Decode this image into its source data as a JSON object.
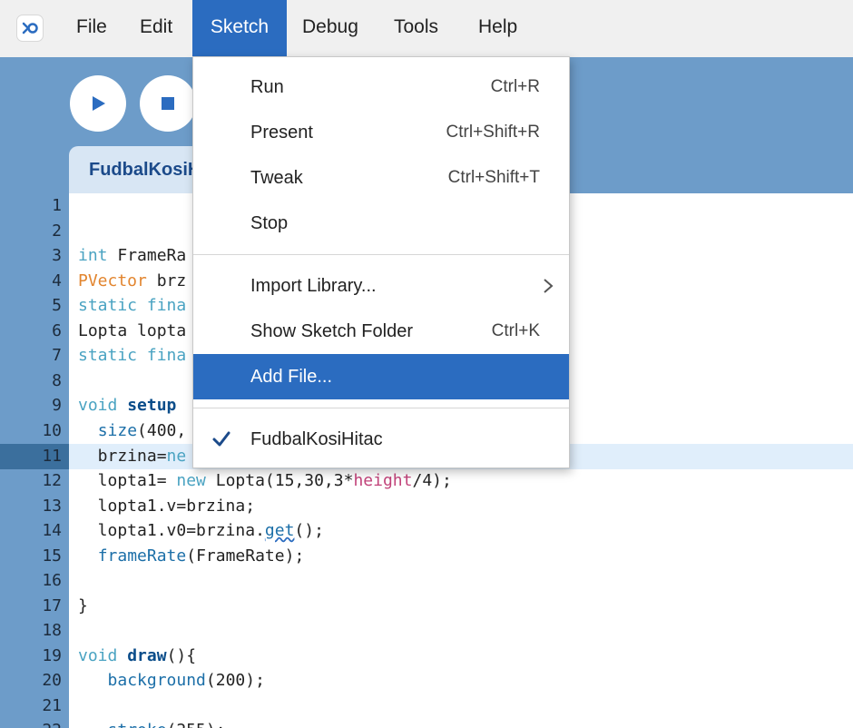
{
  "menubar": {
    "items": [
      {
        "label": "File"
      },
      {
        "label": "Edit"
      },
      {
        "label": "Sketch"
      },
      {
        "label": "Debug"
      },
      {
        "label": "Tools"
      },
      {
        "label": "Help"
      }
    ],
    "active": "Sketch"
  },
  "toolbar": {
    "run_icon": "play-icon",
    "stop_icon": "stop-icon"
  },
  "tab": {
    "label": "FudbalKosiHitac"
  },
  "editor": {
    "current_line": 11,
    "line_numbers": [
      "1",
      "2",
      "3",
      "4",
      "5",
      "6",
      "7",
      "8",
      "9",
      "10",
      "11",
      "12",
      "13",
      "14",
      "15",
      "16",
      "17",
      "18",
      "19",
      "20",
      "21",
      "22"
    ],
    "visible_code": {
      "l3": "int FrameRa",
      "l4": "PVector brz",
      "l5": "static fina",
      "l6": "Lopta lopta",
      "l7": "static fina",
      "l9": "void setup",
      "l10": "  size(400,",
      "l11": "  brzina=ne",
      "l12": "  lopta1= new Lopta(15,30,3*height/4);",
      "l13": "  lopta1.v=brzina;",
      "l14": "  lopta1.v0=brzina.get();",
      "l15": "  frameRate(FrameRate);",
      "l17": "}",
      "l19": "void draw(){",
      "l20": "   background(200);",
      "l22": "   stroke(255);"
    }
  },
  "sketch_menu": {
    "items": [
      {
        "label": "Run",
        "shortcut": "Ctrl+R"
      },
      {
        "label": "Present",
        "shortcut": "Ctrl+Shift+R"
      },
      {
        "label": "Tweak",
        "shortcut": "Ctrl+Shift+T"
      },
      {
        "label": "Stop",
        "shortcut": ""
      },
      {
        "label": "Import Library...",
        "shortcut": ""
      },
      {
        "label": "Show Sketch Folder",
        "shortcut": "Ctrl+K"
      },
      {
        "label": "Add File...",
        "shortcut": ""
      },
      {
        "label": "FudbalKosiHitac",
        "shortcut": ""
      }
    ],
    "selected": "Add File...",
    "checked": "FudbalKosiHitac"
  },
  "colors": {
    "accent": "#2b6cc0",
    "toolbar_bg": "#6d9cc9",
    "menubar_bg": "#f0f0f0",
    "keyword": "#4aa3c2",
    "type": "#e2852f",
    "function": "#1c6fa8"
  }
}
